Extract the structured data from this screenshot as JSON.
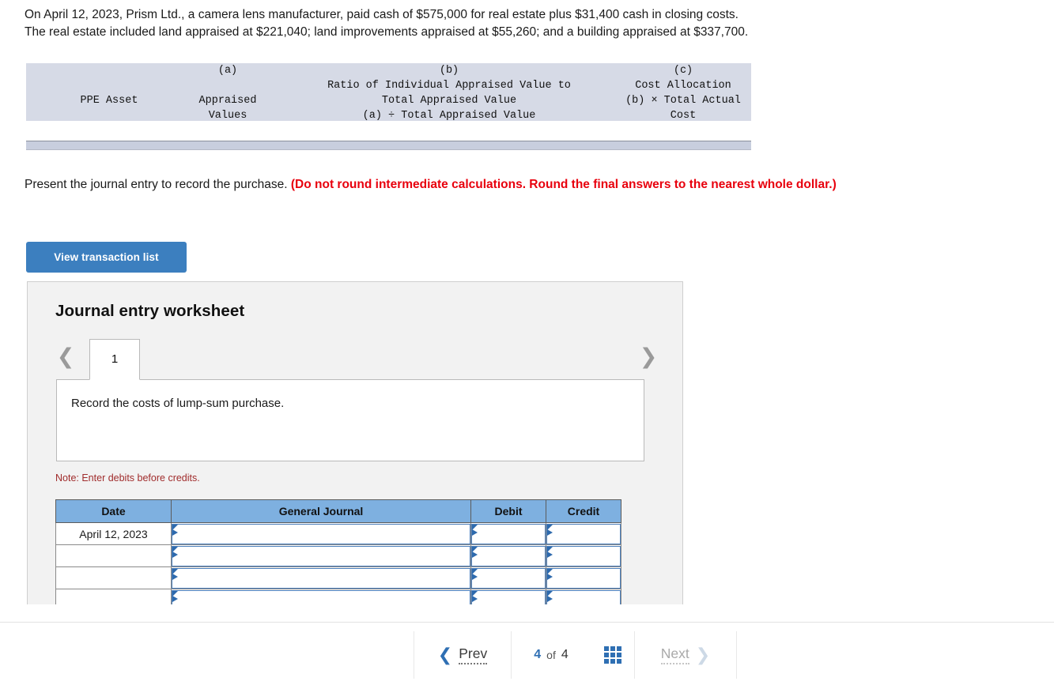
{
  "problem": {
    "line1": "On April 12, 2023, Prism Ltd., a camera lens manufacturer, paid cash of $575,000 for real estate plus $31,400 cash in closing costs.",
    "line2": "The real estate included land appraised at $221,040; land improvements appraised at $55,260; and a building appraised at $337,700."
  },
  "allocation_table": {
    "col_ppe": "PPE Asset",
    "col_a_tag": "(a)",
    "col_a_line1": "Appraised",
    "col_a_line2": "Values",
    "col_b_tag": "(b)",
    "col_b_line1": "Ratio of Individual Appraised Value to",
    "col_b_line2": "Total Appraised Value",
    "col_b_line3": "(a) ÷ Total Appraised Value",
    "col_c_tag": "(c)",
    "col_c_line1": "Cost Allocation",
    "col_c_line2": "(b) × Total Actual",
    "col_c_line3": "Cost"
  },
  "instruction": {
    "normal": "Present the journal entry to record the purchase. ",
    "emphasis": "(Do not round intermediate calculations. Round the final answers to the nearest whole dollar.)"
  },
  "buttons": {
    "view_transaction_list": "View transaction list"
  },
  "worksheet": {
    "title": "Journal entry worksheet",
    "active_tab": "1",
    "description": "Record the costs of lump-sum purchase.",
    "note": "Note: Enter debits before credits.",
    "headers": {
      "date": "Date",
      "general_journal": "General Journal",
      "debit": "Debit",
      "credit": "Credit"
    },
    "rows": [
      {
        "date": "April 12, 2023",
        "general_journal": "",
        "debit": "",
        "credit": ""
      },
      {
        "date": "",
        "general_journal": "",
        "debit": "",
        "credit": ""
      },
      {
        "date": "",
        "general_journal": "",
        "debit": "",
        "credit": ""
      },
      {
        "date": "",
        "general_journal": "",
        "debit": "",
        "credit": ""
      }
    ]
  },
  "footer": {
    "prev_label": "Prev",
    "page_current": "4",
    "page_of": "of",
    "page_total": "4",
    "next_label": "Next"
  },
  "colors": {
    "accent_blue": "#3c7fbf",
    "table_header_blue": "#7eb0e0",
    "alloc_header_bg": "#d6dae6",
    "emphasis_red": "#e8000d",
    "note_red": "#a02c2c",
    "panel_bg": "#f2f2f2"
  }
}
